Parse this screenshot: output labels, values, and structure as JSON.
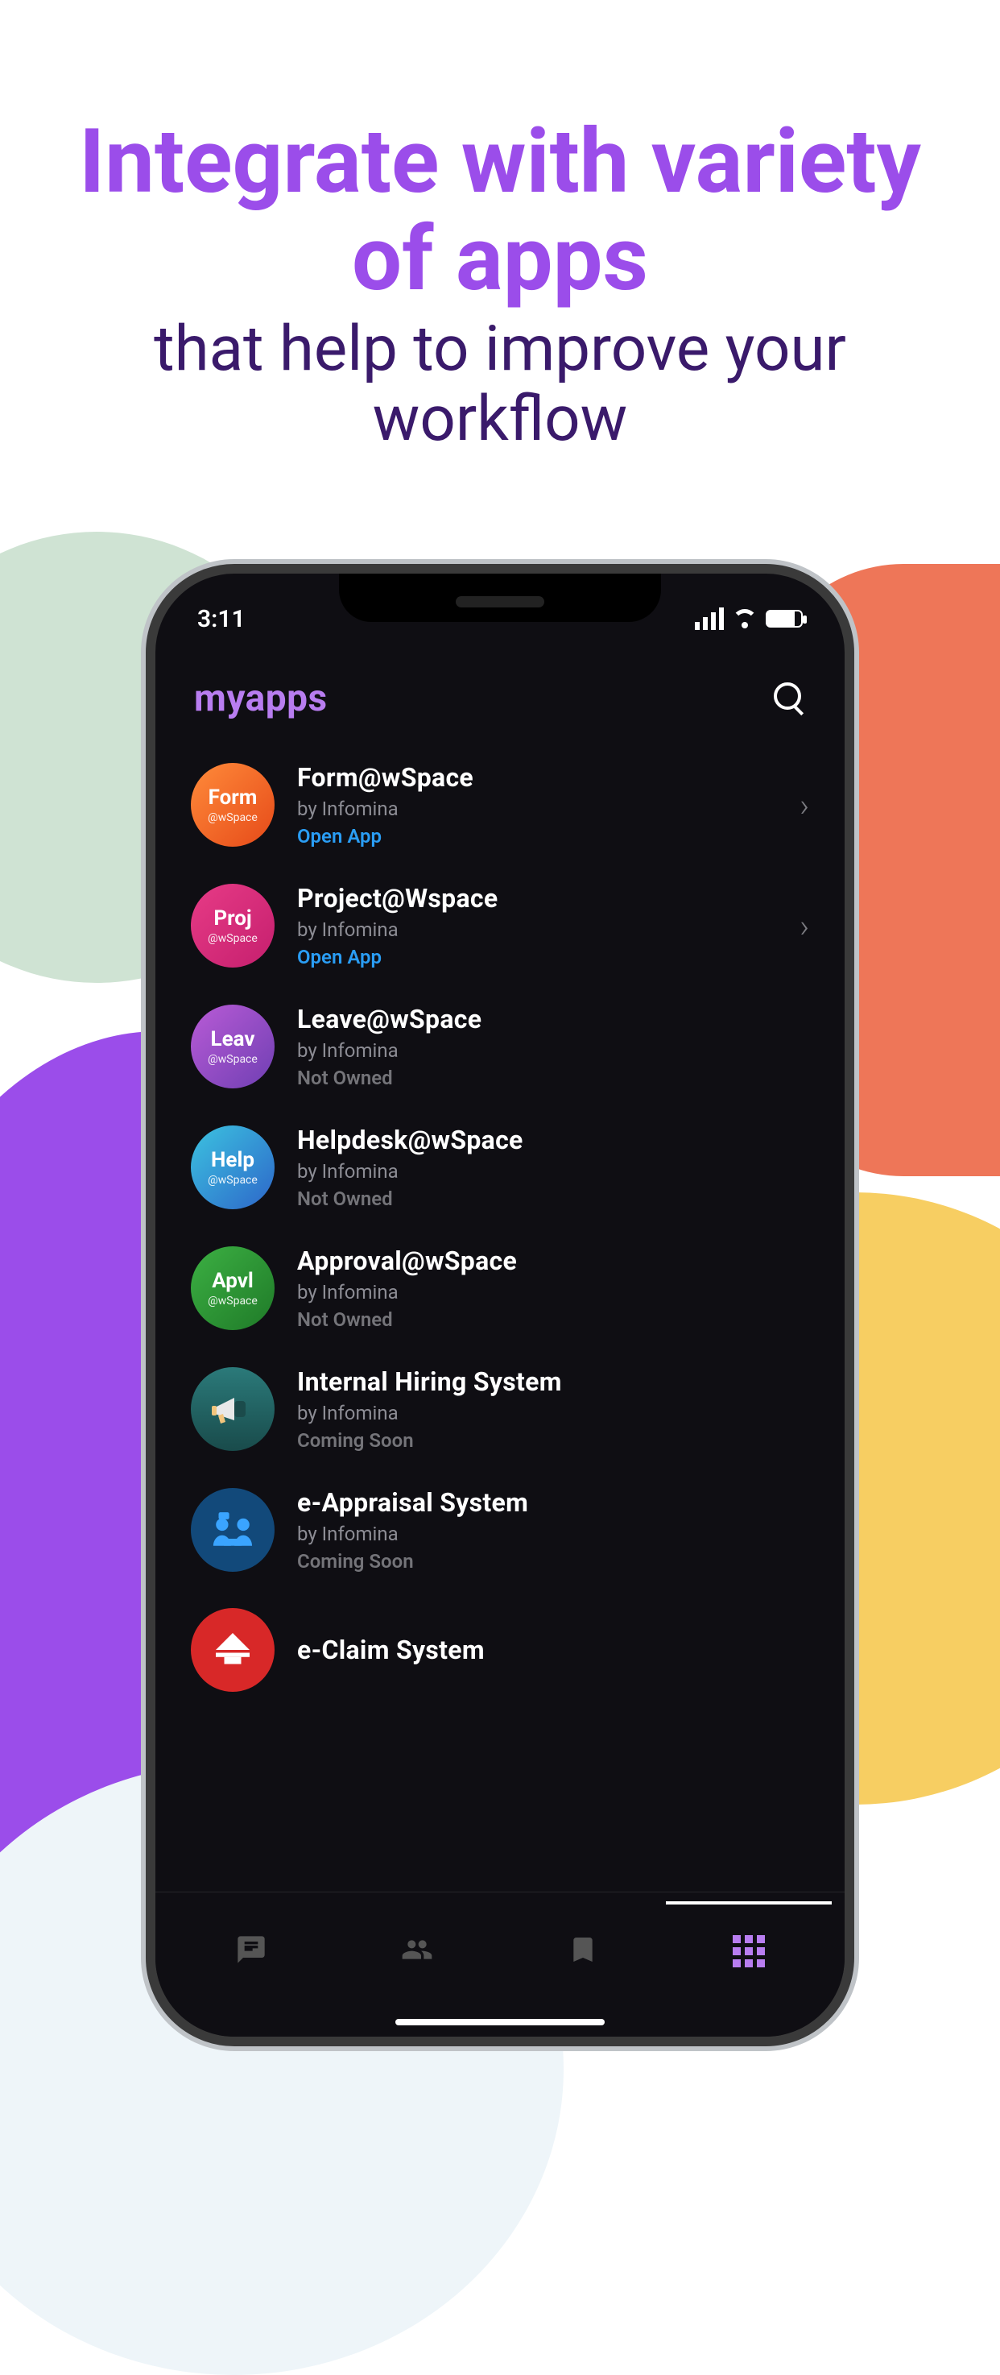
{
  "hero": {
    "title": "Integrate with variety of apps",
    "sub": "that help to improve your workflow"
  },
  "status": {
    "time": "3:11"
  },
  "header": {
    "title": "myapps"
  },
  "apps": [
    {
      "short": "Form",
      "sub": "@wSpace",
      "title": "Form@wSpace",
      "by": "by Infomina",
      "status": "Open App",
      "status_kind": "open",
      "bg": "g-orange",
      "has_chevron": true
    },
    {
      "short": "Proj",
      "sub": "@wSpace",
      "title": "Project@Wspace",
      "by": "by Infomina",
      "status": "Open App",
      "status_kind": "open",
      "bg": "g-pink",
      "has_chevron": true
    },
    {
      "short": "Leav",
      "sub": "@wSpace",
      "title": "Leave@wSpace",
      "by": "by Infomina",
      "status": "Not Owned",
      "status_kind": "owned",
      "bg": "g-purple",
      "has_chevron": false
    },
    {
      "short": "Help",
      "sub": "@wSpace",
      "title": "Helpdesk@wSpace",
      "by": "by Infomina",
      "status": "Not Owned",
      "status_kind": "owned",
      "bg": "g-teal",
      "has_chevron": false
    },
    {
      "short": "Apvl",
      "sub": "@wSpace",
      "title": "Approval@wSpace",
      "by": "by Infomina",
      "status": "Not Owned",
      "status_kind": "owned",
      "bg": "g-green",
      "has_chevron": false
    },
    {
      "icon": "megaphone",
      "title": "Internal Hiring System",
      "by": "by Infomina",
      "status": "Coming Soon",
      "status_kind": "soon",
      "bg": "img-megaphone",
      "has_chevron": false
    },
    {
      "icon": "people",
      "title": "e-Appraisal System",
      "by": "by Infomina",
      "status": "Coming Soon",
      "status_kind": "soon",
      "bg": "img-people",
      "has_chevron": false
    },
    {
      "icon": "scale",
      "title": "e-Claim System",
      "by": "",
      "status": "",
      "status_kind": "soon",
      "bg": "img-scale",
      "has_chevron": false
    }
  ],
  "nav": {
    "items": [
      "chat",
      "people",
      "bookmark",
      "apps"
    ],
    "active": 3
  }
}
